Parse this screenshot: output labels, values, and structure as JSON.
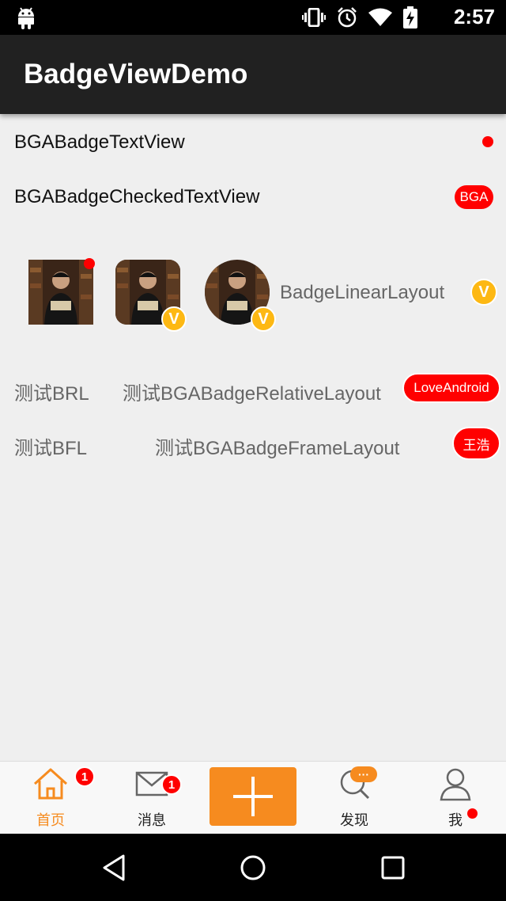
{
  "status_bar": {
    "time": "2:57",
    "icons": [
      "android-icon",
      "vibrate-icon",
      "alarm-icon",
      "wifi-icon",
      "battery-charging-icon"
    ]
  },
  "app_bar": {
    "title": "BadgeViewDemo"
  },
  "rows": {
    "badge_text_view": {
      "label": "BGABadgeTextView"
    },
    "badge_checked_text_view": {
      "label": "BGABadgeCheckedTextView",
      "badge": "BGA"
    },
    "linear_layout": {
      "label": "BadgeLinearLayout",
      "badge": "V",
      "avatar_badge": "V"
    },
    "relative_layout": {
      "left_label": "测试BRL",
      "label": "测试BGABadgeRelativeLayout",
      "badge": "LoveAndroid"
    },
    "frame_layout": {
      "left_label": "测试BFL",
      "label": "测试BGABadgeFrameLayout",
      "badge": "王浩"
    }
  },
  "tabs": [
    {
      "label": "首页",
      "icon": "home-icon",
      "badge": "1",
      "active": true
    },
    {
      "label": "消息",
      "icon": "mail-icon",
      "badge": "1",
      "active": false
    },
    {
      "label": "发现",
      "icon": "discover-icon",
      "badge": "···",
      "active": false
    },
    {
      "label": "我",
      "icon": "user-icon",
      "badge": "",
      "active": false
    }
  ],
  "colors": {
    "accent": "#f68b1f",
    "badge_red": "#ff0000",
    "v_badge": "#fdb813",
    "app_bar": "#212121"
  }
}
